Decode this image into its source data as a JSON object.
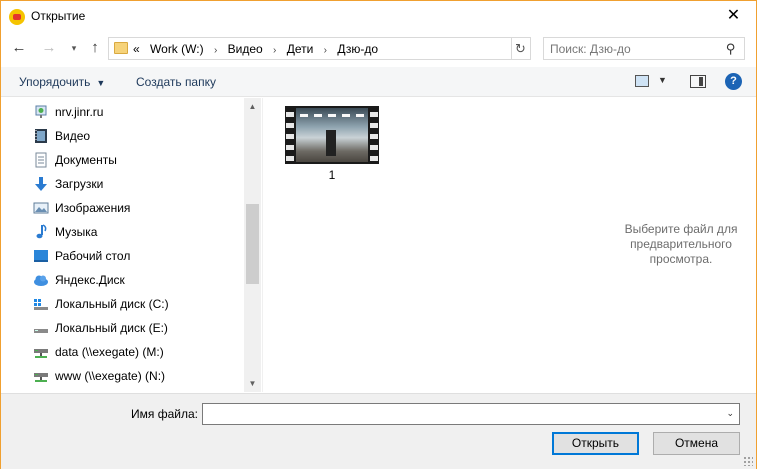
{
  "window": {
    "title": "Открытие",
    "close_label": "✕"
  },
  "nav": {
    "back_icon": "←",
    "forward_icon": "→",
    "recent_icon": "▾",
    "up_icon": "↑",
    "breadcrumb_overflow": "«",
    "breadcrumbs": [
      "Work (W:)",
      "Видео",
      "Дети",
      "Дзю-до"
    ],
    "separator": "›",
    "dropdown_icon": "⌄",
    "refresh_icon": "↻",
    "search_placeholder": "Поиск: Дзю-до",
    "search_icon": "⚲"
  },
  "toolbar": {
    "organize_label": "Упорядочить",
    "organize_caret": "▼",
    "new_folder_label": "Создать папку",
    "view_caret": "▼",
    "help_label": "?"
  },
  "sidebar": {
    "items": [
      {
        "label": "nrv.jinr.ru",
        "icon": "network-location-icon"
      },
      {
        "label": "Видео",
        "icon": "videos-icon"
      },
      {
        "label": "Документы",
        "icon": "documents-icon"
      },
      {
        "label": "Загрузки",
        "icon": "downloads-icon"
      },
      {
        "label": "Изображения",
        "icon": "pictures-icon"
      },
      {
        "label": "Музыка",
        "icon": "music-icon"
      },
      {
        "label": "Рабочий стол",
        "icon": "desktop-icon"
      },
      {
        "label": "Яндекс.Диск",
        "icon": "cloud-drive-icon"
      },
      {
        "label": "Локальный диск (C:)",
        "icon": "system-drive-icon"
      },
      {
        "label": "Локальный диск (E:)",
        "icon": "drive-icon"
      },
      {
        "label": "data (\\\\exegate) (M:)",
        "icon": "network-drive-icon"
      },
      {
        "label": "www (\\\\exegate) (N:)",
        "icon": "network-drive-icon"
      }
    ],
    "scroll_up": "▲",
    "scroll_down": "▼"
  },
  "content": {
    "files": [
      {
        "name": "1",
        "type": "video"
      }
    ]
  },
  "preview": {
    "message": "Выберите файл для предварительного просмотра."
  },
  "footer": {
    "filename_label": "Имя файла:",
    "filename_value": "",
    "filename_dropdown": "⌄",
    "open_label": "Открыть",
    "cancel_label": "Отмена"
  },
  "colors": {
    "window_border": "#f0a030",
    "accent": "#0078d7",
    "toolbar_text": "#1e395b",
    "help": "#1c64b5"
  }
}
